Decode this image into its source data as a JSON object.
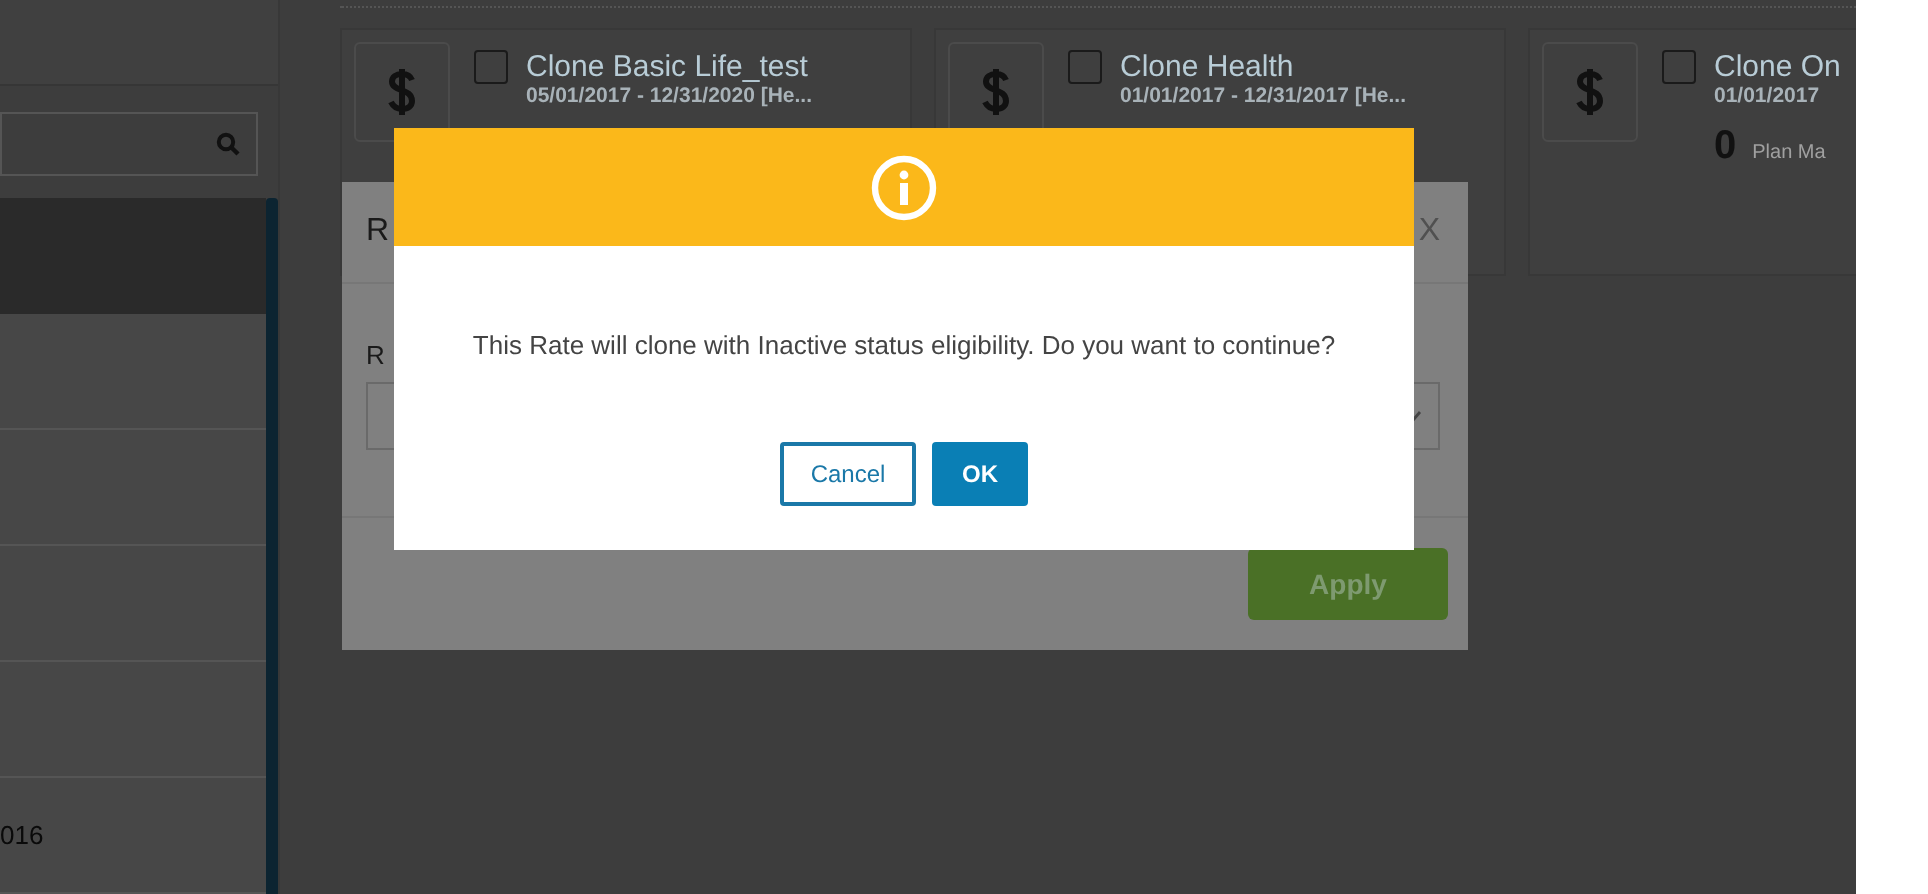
{
  "left_panel": {
    "rows": [
      {
        "selected": true
      },
      {
        "selected": false
      },
      {
        "selected": false
      },
      {
        "selected": false
      },
      {
        "selected": false
      },
      {
        "text": "016",
        "selected": false
      }
    ]
  },
  "cards": [
    {
      "title": "Clone Basic Life_test",
      "dates": "05/01/2017 - 12/31/2020 [He...",
      "checked": false
    },
    {
      "title": "Clone Health",
      "dates": "01/01/2017 - 12/31/2017 [He...",
      "checked": false
    },
    {
      "title": "Clone On",
      "dates": "01/01/2017",
      "checked": false,
      "count": "0",
      "count_label": "Plan Ma"
    }
  ],
  "rate_modal": {
    "title": "R",
    "close": "X",
    "field_label": "R",
    "apply": "Apply"
  },
  "alert": {
    "message": "This Rate will clone with Inactive status eligibility. Do you want to continue?",
    "buttons": [
      {
        "label": "Cancel",
        "kind": "secondary"
      },
      {
        "label": "OK",
        "kind": "primary"
      }
    ]
  }
}
